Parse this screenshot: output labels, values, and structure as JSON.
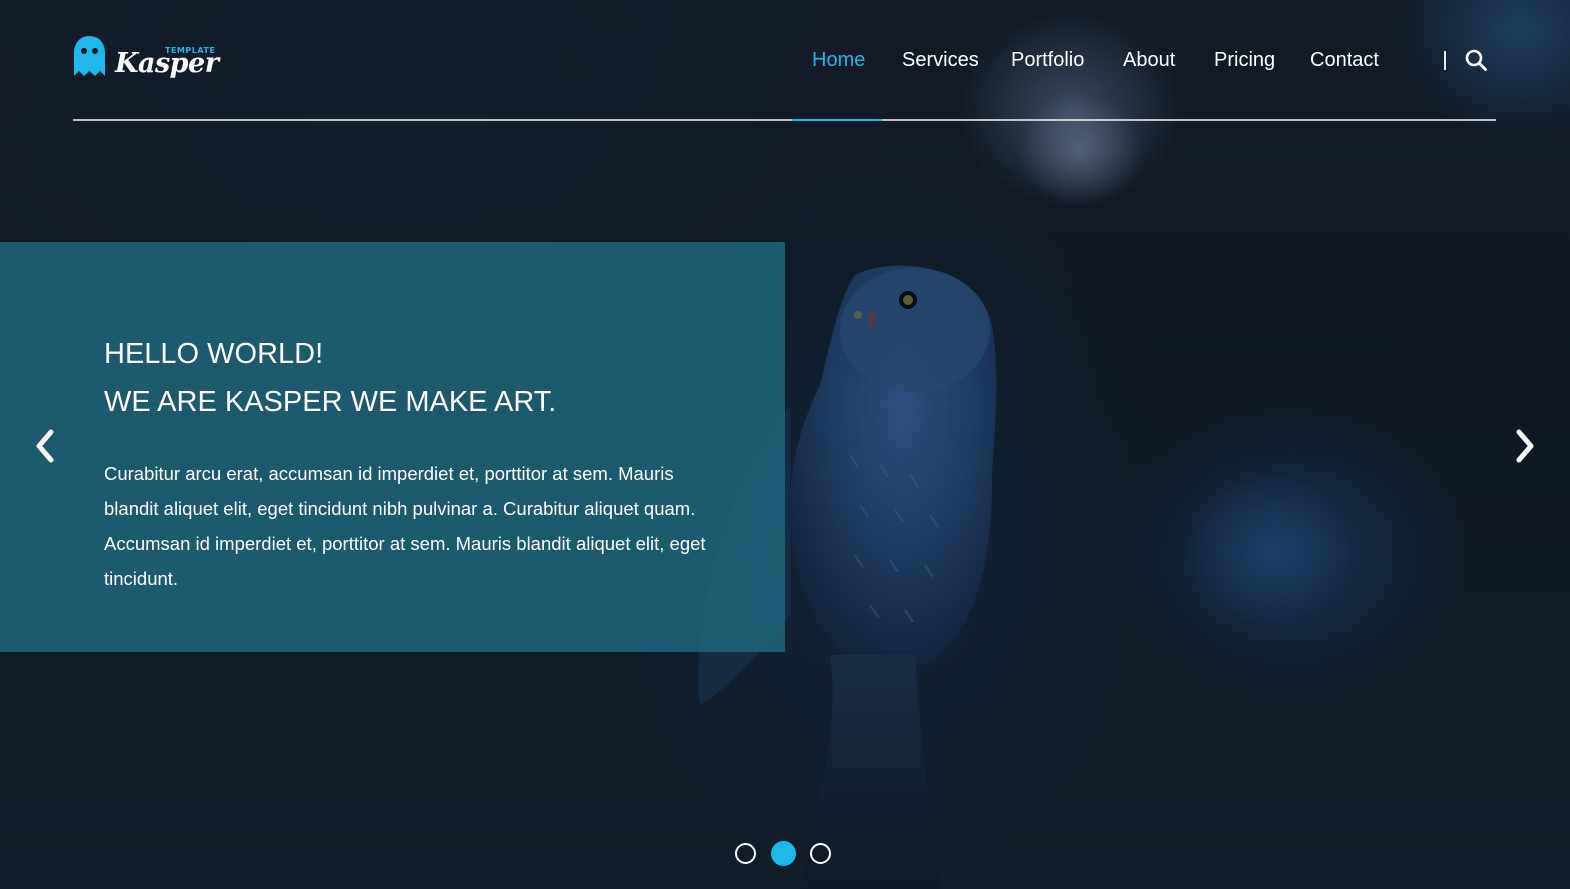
{
  "brand": {
    "logo_small": "TEMPLATE",
    "logo_word": "Kasper",
    "accent_color": "#1fb6e8",
    "logo_icon": "ghost-icon"
  },
  "nav": {
    "items": [
      {
        "label": "Home",
        "active": true
      },
      {
        "label": "Services",
        "active": false
      },
      {
        "label": "Portfolio",
        "active": false
      },
      {
        "label": "About",
        "active": false
      },
      {
        "label": "Pricing",
        "active": false
      },
      {
        "label": "Contact",
        "active": false
      }
    ],
    "search_icon": "search-icon"
  },
  "hero": {
    "title_line1": "HELLO WORLD!",
    "title_line2": "WE ARE KASPER WE MAKE ART.",
    "text": "Curabitur arcu erat, accumsan id imperdiet et, porttitor at sem. Mauris blandit aliquet elit, eget tincidunt nibh pulvinar a. Curabitur aliquet quam. Accumsan id imperdiet et, porttitor at sem. Mauris blandit aliquet elit, eget tincidunt.",
    "box_color": "#1f667d",
    "prev_icon": "chevron-left-icon",
    "next_icon": "chevron-right-icon"
  },
  "slider": {
    "slide_count": 3,
    "active_index": 1
  }
}
